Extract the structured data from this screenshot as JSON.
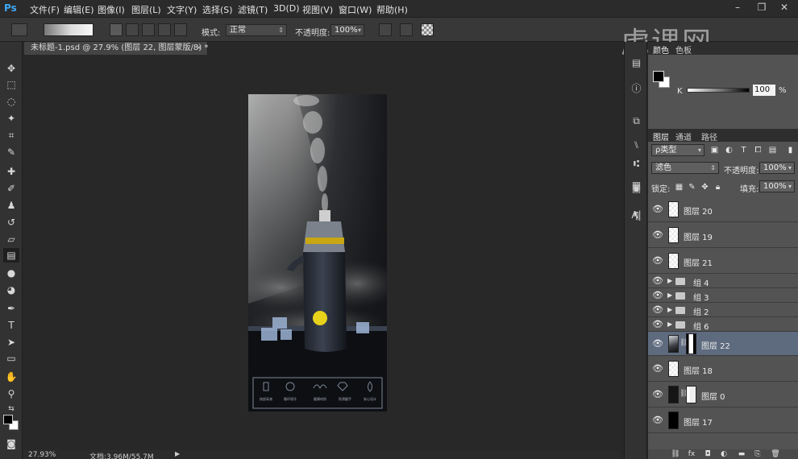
{
  "app": {
    "logo": "Ps"
  },
  "menu": [
    "文件(F)",
    "编辑(E)",
    "图像(I)",
    "图层(L)",
    "文字(Y)",
    "选择(S)",
    "滤镜(T)",
    "3D(D)",
    "视图(V)",
    "窗口(W)",
    "帮助(H)"
  ],
  "window_controls": {
    "minimize": "–",
    "restore": "❐",
    "close": "✕"
  },
  "options": {
    "mode_label": "模式:",
    "mode_value": "正常",
    "opacity_label": "不透明度:",
    "opacity_value": "100%"
  },
  "watermark": "虎课网",
  "document": {
    "tab_title": "未标题-1.psd @ 27.9% (图层 22, 图层蒙版/8) *",
    "zoom": "27.93%",
    "doc_info": "文档:3.96M/55.7M"
  },
  "artwork": {
    "features": [
      "按部采液",
      "循环保冷",
      "健康材质",
      "防滑握手",
      "安心设计"
    ]
  },
  "color_panel": {
    "tabs": [
      "颜色",
      "色板"
    ],
    "channel_label": "K",
    "channel_value": "100",
    "unit": "%"
  },
  "layers_panel": {
    "tabs": [
      "图层",
      "通道",
      "路径"
    ],
    "kind_filter": "ρ类型",
    "blend_mode": "滤色",
    "opacity_label": "不透明度:",
    "opacity_value": "100%",
    "lock_label": "锁定:",
    "fill_label": "填充:",
    "fill_value": "100%",
    "layers": [
      {
        "name": "图层 20",
        "type": "pixel"
      },
      {
        "name": "图层 19",
        "type": "pixel"
      },
      {
        "name": "图层 21",
        "type": "pixel"
      },
      {
        "name": "组 4",
        "type": "group"
      },
      {
        "name": "组 3",
        "type": "group"
      },
      {
        "name": "组 2",
        "type": "group"
      },
      {
        "name": "组 6",
        "type": "group"
      },
      {
        "name": "图层 22",
        "type": "masked",
        "selected": true
      },
      {
        "name": "图层 18",
        "type": "pixel"
      },
      {
        "name": "图层 0",
        "type": "masked-black"
      },
      {
        "name": "图层 17",
        "type": "black"
      }
    ],
    "footer_icons": [
      "link-icon",
      "fx-icon",
      "mask-icon",
      "adjustment-icon",
      "folder-icon",
      "new-layer-icon",
      "trash-icon"
    ]
  },
  "colors": {
    "accent": "#3fa9f5",
    "selected_layer": "#5e6a7e",
    "panel_bg": "#535353",
    "app_bg": "#282828"
  }
}
